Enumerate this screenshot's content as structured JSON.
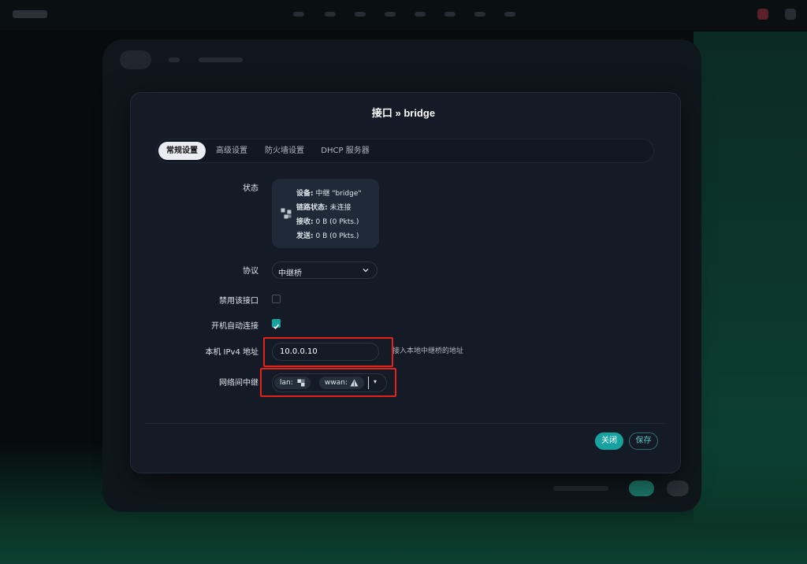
{
  "modal": {
    "title": "接口 » bridge",
    "tabs": [
      {
        "label": "常规设置",
        "active": true
      },
      {
        "label": "高级设置"
      },
      {
        "label": "防火墙设置"
      },
      {
        "label": "DHCP 服务器"
      }
    ],
    "fields": {
      "status_label": "状态",
      "protocol_label": "协议",
      "disable_label": "禁用该接口",
      "autostart_label": "开机自动连接",
      "ipv4_label": "本机 IPv4 地址",
      "relay_label": "网络间中继"
    },
    "status": {
      "device_key": "设备:",
      "device_val": "中继 \"bridge\"",
      "link_key": "链路状态:",
      "link_val": "未连接",
      "rx_key": "接收:",
      "rx_val": "0 B (0 Pkts.)",
      "tx_key": "发送:",
      "tx_val": "0 B (0 Pkts.)"
    },
    "protocol": {
      "value": "中继桥"
    },
    "disable_checked": false,
    "autostart_checked": true,
    "ipv4": {
      "value": "10.0.0.10",
      "hint": "接入本地中继桥的地址"
    },
    "relay": {
      "chips": [
        {
          "label": "lan:",
          "icon": "ethernet-port-icon"
        },
        {
          "label": "wwan:",
          "icon": "wifi-signal-icon"
        }
      ],
      "dropdown": "▾"
    },
    "buttons": {
      "close": "关闭",
      "save": "保存"
    },
    "colors": {
      "accent": "#17a2a0",
      "highlight": "#e2231a"
    }
  }
}
